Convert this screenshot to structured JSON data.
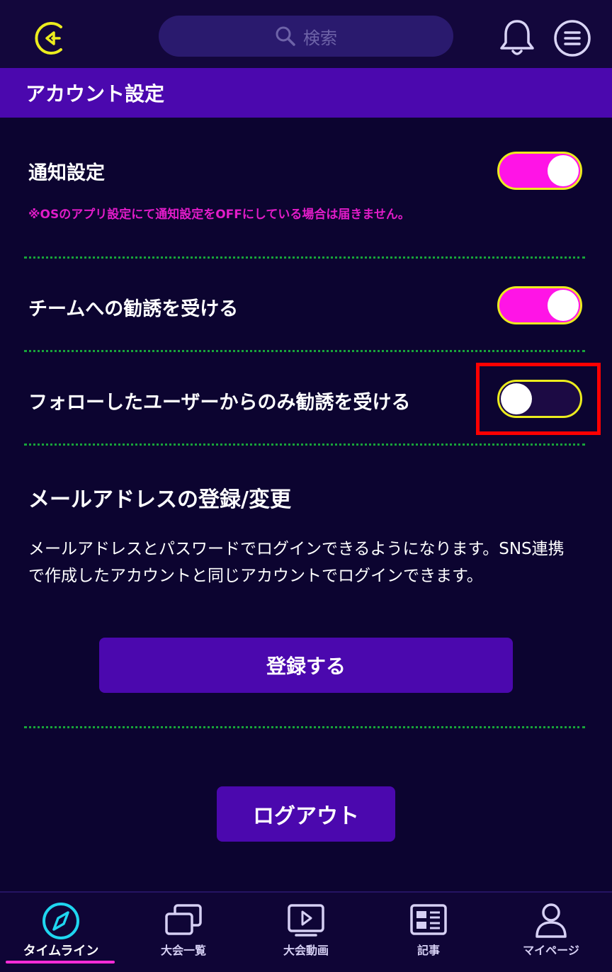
{
  "header": {
    "search_placeholder": "検索",
    "icons": {
      "back": "back-arrow-icon",
      "notifications": "bell-icon",
      "menu": "menu-icon"
    }
  },
  "page": {
    "title": "アカウント設定"
  },
  "settings": [
    {
      "label": "通知設定",
      "note": "※OSのアプリ設定にて通知設定をOFFにしている場合は届きません。",
      "enabled": true
    },
    {
      "label": "チームへの勧誘を受ける",
      "enabled": true
    },
    {
      "label": "フォローしたユーザーからのみ勧誘を受ける",
      "enabled": false
    }
  ],
  "email": {
    "title": "メールアドレスの登録/変更",
    "description": "メールアドレスとパスワードでログインできるようになります。SNS連携で作成したアカウントと同じアカウントでログインできます。",
    "register_label": "登録する"
  },
  "logout_label": "ログアウト",
  "nav": [
    {
      "label": "タイムライン",
      "icon": "compass-icon",
      "active": true
    },
    {
      "label": "大会一覧",
      "icon": "stacked-windows-icon",
      "active": false
    },
    {
      "label": "大会動画",
      "icon": "video-play-icon",
      "active": false
    },
    {
      "label": "記事",
      "icon": "article-icon",
      "active": false
    },
    {
      "label": "マイページ",
      "icon": "user-icon",
      "active": false
    }
  ],
  "colors": {
    "background": "#0c0430",
    "accent_purple": "#4b08ae",
    "toggle_on": "#ff14e6",
    "toggle_border": "#ecec1e",
    "note_text": "#e11cc8",
    "divider": "#18a43a",
    "active_nav": "#1fd6f0"
  }
}
